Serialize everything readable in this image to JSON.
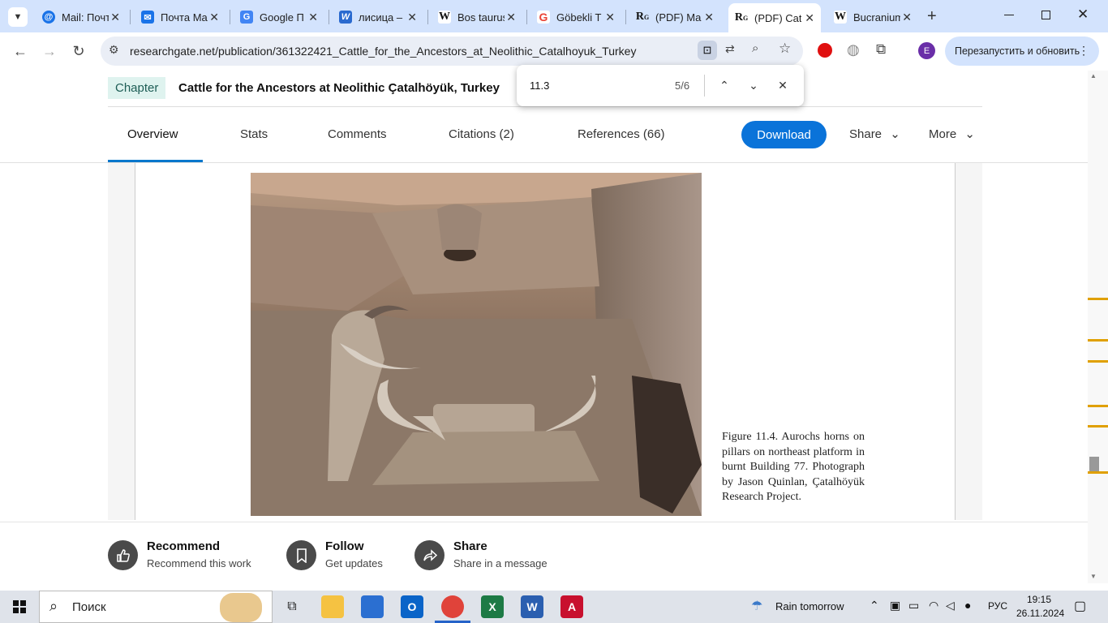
{
  "browser": {
    "tabs": [
      {
        "title": "Mail: Почта",
        "icon": "at-icon",
        "color": "#1a73e8"
      },
      {
        "title": "Почта Mail",
        "icon": "mail-icon",
        "color": "#1a73e8"
      },
      {
        "title": "Google П",
        "icon": "translate-icon",
        "color": "#4285f4"
      },
      {
        "title": "лисица –",
        "icon": "site-icon",
        "color": "#2a6acf"
      },
      {
        "title": "Bos taurus",
        "icon": "wikipedia-icon",
        "color": "#333333"
      },
      {
        "title": "Göbekli T",
        "icon": "google-icon",
        "color": "#ea4335"
      },
      {
        "title": "(PDF) Ma",
        "icon": "researchgate-icon",
        "color": "#111111"
      },
      {
        "title": "(PDF) Cat",
        "icon": "researchgate-icon",
        "color": "#111111"
      },
      {
        "title": "Bucranium",
        "icon": "wikipedia-icon",
        "color": "#333333"
      }
    ],
    "url": "researchgate.net/publication/361322421_Cattle_for_the_Ancestors_at_Neolithic_Catalhoyuk_Turkey",
    "profile_letter": "E",
    "relaunch_label": "Перезапустить и обновить"
  },
  "find_bar": {
    "query": "11.3",
    "count": "5/6"
  },
  "header": {
    "badge": "Chapter",
    "title": "Cattle for the Ancestors at Neolithic Çatalhöyük, Turkey"
  },
  "nav": {
    "tabs": [
      "Overview",
      "Stats",
      "Comments",
      "Citations (2)",
      "References (66)"
    ],
    "download": "Download",
    "share": "Share",
    "more": "More"
  },
  "figure": {
    "caption": "Figure 11.4. Aurochs horns on pillars on northeast platform in burnt Building 77. Photograph by Jason Quinlan, Çatalhöyük Research Project."
  },
  "actions": [
    {
      "title": "Recommend",
      "subtitle": "Recommend this work",
      "icon": "thumbs-up-icon"
    },
    {
      "title": "Follow",
      "subtitle": "Get updates",
      "icon": "bookmark-icon"
    },
    {
      "title": "Share",
      "subtitle": "Share in a message",
      "icon": "share-arrow-icon"
    }
  ],
  "taskbar": {
    "search_label": "Поиск",
    "weather": "Rain tomorrow",
    "lang": "РУС",
    "time": "19:15",
    "date": "26.11.2024"
  }
}
